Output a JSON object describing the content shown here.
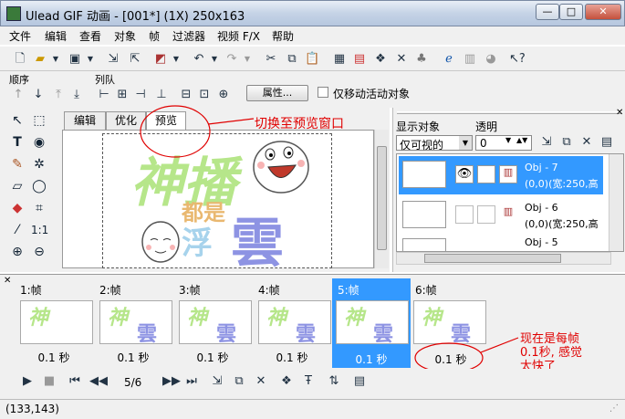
{
  "window": {
    "title": "Ulead GIF 动画 - [001*] (1X) 250x163",
    "min": "—",
    "max": "□",
    "close": "✕"
  },
  "menu": [
    "文件",
    "编辑",
    "查看",
    "对象",
    "帧",
    "过滤器",
    "视频 F/X",
    "帮助"
  ],
  "toolbar2": {
    "order_label": "顺序",
    "align_label": "列队",
    "properties_button": "属性...",
    "move_active_label": "仅移动活动对象"
  },
  "tabs": [
    "编辑",
    "优化",
    "预览"
  ],
  "image_art": {
    "big_green": "神播",
    "small_orange": "都是",
    "blue_left": "浮",
    "blue_right": "雲"
  },
  "object_panel": {
    "display_label": "显示对象",
    "transparency_label": "透明",
    "display_value": "仅可视的",
    "transparency_value": "0",
    "objects": [
      {
        "name": "Obj - 7",
        "info": "(0,0)(宽:250,高",
        "selected": true
      },
      {
        "name": "Obj - 6",
        "info": "(0,0)(宽:250,高",
        "selected": false
      },
      {
        "name": "Obj - 5",
        "info": "",
        "selected": false
      }
    ]
  },
  "frames": [
    {
      "label": "1:帧",
      "delay": "0.1 秒",
      "selected": false
    },
    {
      "label": "2:帧",
      "delay": "0.1 秒",
      "selected": false
    },
    {
      "label": "3:帧",
      "delay": "0.1 秒",
      "selected": false
    },
    {
      "label": "4:帧",
      "delay": "0.1 秒",
      "selected": false
    },
    {
      "label": "5:帧",
      "delay": "0.1 秒",
      "selected": true
    },
    {
      "label": "6:帧",
      "delay": "0.1 秒",
      "selected": false
    }
  ],
  "frame_counter": "5/6",
  "status": "(133,143)",
  "annotations": {
    "switch_preview": "切换至预览窗口",
    "note": "现在是每帧\n0.1秒, 感觉\n太快了"
  },
  "colors": {
    "selection": "#3399ff",
    "annotation": "#e00000",
    "art_green": "#b6e68a",
    "art_blue": "#8d93e3"
  }
}
